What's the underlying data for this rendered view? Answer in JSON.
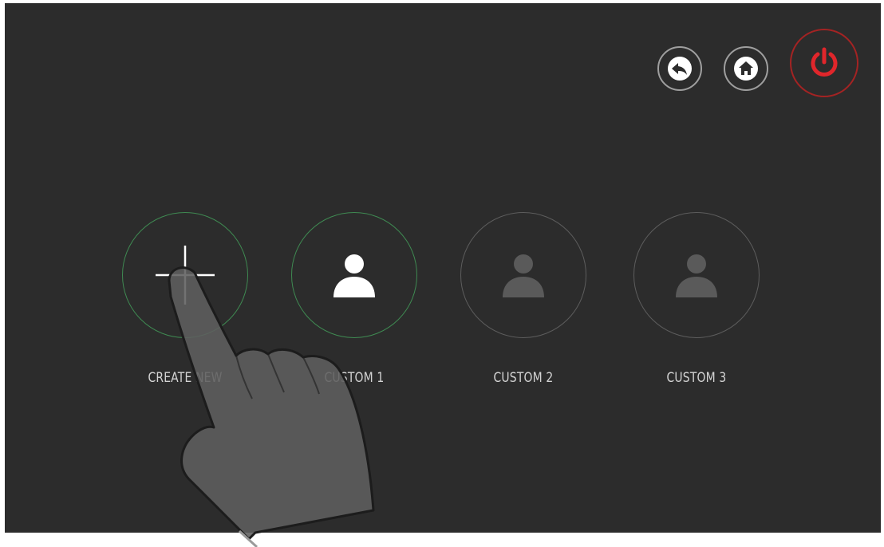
{
  "top_controls": {
    "back_icon": "back-arrow-icon",
    "home_icon": "home-icon",
    "power_icon": "power-icon",
    "power_color": "#e0262b"
  },
  "profiles": [
    {
      "label": "CREATE NEW",
      "icon": "plus-icon",
      "state": "active"
    },
    {
      "label": "CUSTOM 1",
      "icon": "user-icon",
      "state": "active"
    },
    {
      "label": "CUSTOM 2",
      "icon": "user-icon",
      "state": "inactive"
    },
    {
      "label": "CUSTOM 3",
      "icon": "user-icon",
      "state": "inactive"
    }
  ],
  "colors": {
    "background": "#2c2c2c",
    "active_ring": "#3f8a52",
    "inactive_ring": "#5d5d5d",
    "active_icon": "#ffffff",
    "inactive_icon": "#5a5a5a"
  },
  "overlay": {
    "icon": "pointing-hand-icon"
  }
}
